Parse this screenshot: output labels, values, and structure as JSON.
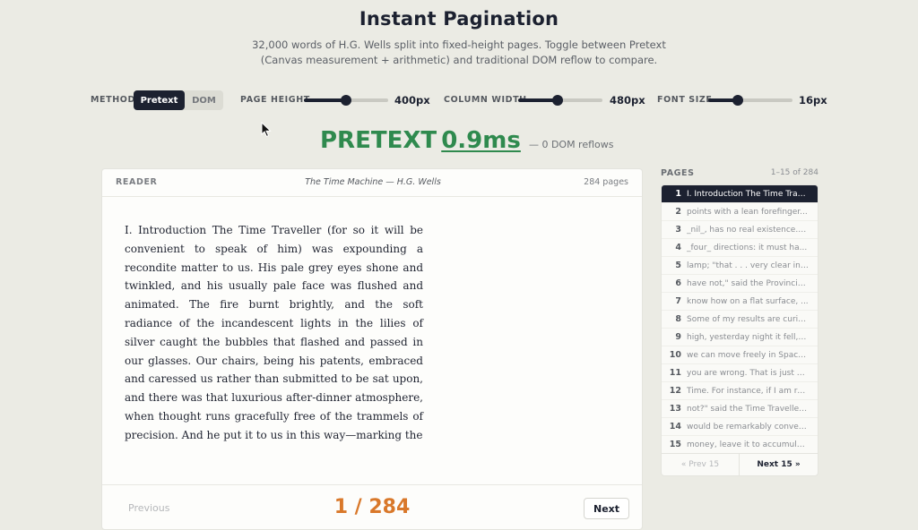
{
  "header": {
    "title": "Instant Pagination",
    "subtitle_line1": "32,000 words of H.G. Wells split into fixed-height pages. Toggle between Pretext",
    "subtitle_line2": "(Canvas measurement + arithmetic) and traditional DOM reflow to compare."
  },
  "controls": {
    "method_label": "METHOD",
    "method_options": [
      "Pretext",
      "DOM"
    ],
    "method_selected": "Pretext",
    "page_height_label": "PAGE HEIGHT",
    "page_height_value": "400px",
    "page_height_level": 0.5,
    "column_width_label": "COLUMN WIDTH",
    "column_width_value": "480px",
    "column_width_level": 0.47,
    "font_size_label": "FONT SIZE",
    "font_size_value": "16px",
    "font_size_level": 0.35
  },
  "metric": {
    "label": "PRETEXT",
    "value": "0.9ms",
    "note": "— 0 DOM reflows"
  },
  "reader": {
    "label": "READER",
    "book": "The Time Machine — H.G. Wells",
    "page_count": "284 pages",
    "text": "I. Introduction The Time Traveller (for so it will be convenient to speak of him) was expounding a recondite matter to us. His pale grey eyes shone and twinkled, and his usually pale face was flushed and animated. The fire burnt brightly, and the soft radiance of the incandescent lights in the lilies of silver caught the bubbles that flashed and passed in our glasses. Our chairs, being his patents, embraced and caressed us rather than submitted to be sat upon, and there was that luxurious after-dinner atmosphere, when thought runs gracefully free of the trammels of precision. And he put it to us in this way—marking the",
    "prev_label": "Previous",
    "counter": "1 / 284",
    "next_label": "Next"
  },
  "pages": {
    "label": "PAGES",
    "range": "1–15 of 284",
    "items": [
      {
        "num": "1",
        "snippet": "I. Introduction The Time Travel..."
      },
      {
        "num": "2",
        "snippet": "points with a lean forefinger..."
      },
      {
        "num": "3",
        "snippet": "_nil_, has no real existence. T..."
      },
      {
        "num": "4",
        "snippet": "_four_ directions: it must ha..."
      },
      {
        "num": "5",
        "snippet": "lamp; \"that . . . very clear inde..."
      },
      {
        "num": "6",
        "snippet": "have not,\" said the Provincial ..."
      },
      {
        "num": "7",
        "snippet": "know how on a flat surface, ..."
      },
      {
        "num": "8",
        "snippet": "Some of my results are curio..."
      },
      {
        "num": "9",
        "snippet": "high, yesterday night it fell, t..."
      },
      {
        "num": "10",
        "snippet": "we can move freely in Space..."
      },
      {
        "num": "11",
        "snippet": "you are wrong. That is just w..."
      },
      {
        "num": "12",
        "snippet": "Time. For instance, if I am rec..."
      },
      {
        "num": "13",
        "snippet": "not?\" said the Time Traveller. ..."
      },
      {
        "num": "14",
        "snippet": "would be remarkably conveni..."
      },
      {
        "num": "15",
        "snippet": "money, leave it to accumulat..."
      }
    ],
    "prev15": "« Prev 15",
    "next15": "Next 15 »"
  }
}
